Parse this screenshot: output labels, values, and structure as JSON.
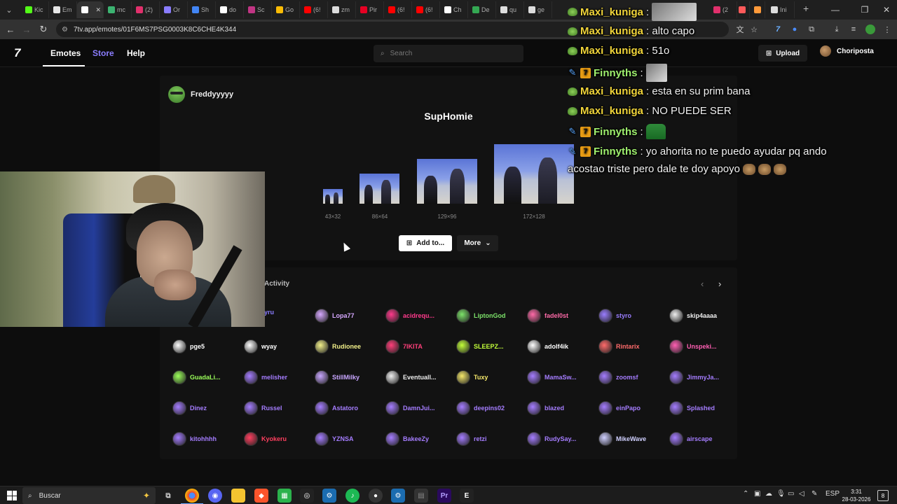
{
  "browser": {
    "tabs": [
      {
        "label": "Kic",
        "color": "#53fc18"
      },
      {
        "label": "Em",
        "color": "#e6e6e6"
      },
      {
        "label": "",
        "color": "#ffffff"
      },
      {
        "label": "mc",
        "color": "#3cb371"
      },
      {
        "label": "(2)",
        "color": "#e1306c"
      },
      {
        "label": "Or",
        "color": "#8a7dff"
      },
      {
        "label": "Sh",
        "color": "#4285f4"
      },
      {
        "label": "do",
        "color": "#ffffff"
      },
      {
        "label": "Sc",
        "color": "#c13584"
      },
      {
        "label": "Go",
        "color": "#fbbc05"
      },
      {
        "label": "(6!",
        "color": "#ff0000"
      },
      {
        "label": "zm",
        "color": "#dddddd"
      },
      {
        "label": "Pir",
        "color": "#e60023"
      },
      {
        "label": "(6!",
        "color": "#ff0000"
      },
      {
        "label": "(6!",
        "color": "#ff0000"
      },
      {
        "label": "Ch",
        "color": "#ffffff"
      },
      {
        "label": "De",
        "color": "#34a853"
      },
      {
        "label": "qu",
        "color": "#dddddd"
      },
      {
        "label": "ge",
        "color": "#dddddd"
      }
    ],
    "url": "7tv.app/emotes/01F6MS7PSG0003K8C6CHE4K344",
    "right_tabs": [
      {
        "label": "(2"
      },
      {
        "label": "Ini"
      }
    ]
  },
  "site": {
    "logo": "7",
    "nav": {
      "emotes": "Emotes",
      "store": "Store",
      "help": "Help"
    },
    "search_placeholder": "Search",
    "upload": "Upload",
    "username": "Choriposta"
  },
  "emote": {
    "uploader": "Freddyyyyy",
    "name": "SupHomie",
    "sizes": [
      "43×32",
      "86×64",
      "129×96",
      "172×128"
    ],
    "add_to": "Add to...",
    "more": "More"
  },
  "activity": {
    "title": "Activity",
    "rows": [
      [
        {
          "name": "yru",
          "color": "#8b7dff"
        },
        {
          "name": "Lopa77",
          "color": "#d6a8ff"
        },
        {
          "name": "acidrequ...",
          "color": "#ff3a8c"
        },
        {
          "name": "LiptonGod",
          "color": "#7de36a"
        },
        {
          "name": "fadel0st",
          "color": "#ff6aa8"
        },
        {
          "name": "styro",
          "color": "#9a7dff"
        },
        {
          "name": "skip4aaaa",
          "color": "#eeeeee"
        }
      ],
      [
        {
          "name": "pge5",
          "color": "#ffffff"
        },
        {
          "name": "wyay",
          "color": "#ffffff"
        },
        {
          "name": "Rudionee",
          "color": "#f2f08a"
        },
        {
          "name": "7IKITA",
          "color": "#ff3f7a"
        },
        {
          "name": "SLEEPZ...",
          "color": "#c3ff3a"
        },
        {
          "name": "adolf4ik",
          "color": "#ffffff"
        },
        {
          "name": "Rintarix",
          "color": "#ff6b6b"
        },
        {
          "name": "Unspeki...",
          "color": "#ff5fb3"
        }
      ],
      [
        {
          "name": "GuadaLi...",
          "color": "#9bff5a"
        },
        {
          "name": "melisher",
          "color": "#a57dff"
        },
        {
          "name": "StillMilky",
          "color": "#c8a6ff"
        },
        {
          "name": "Eventuall...",
          "color": "#eeeeee"
        },
        {
          "name": "Tuxy",
          "color": "#f5e86a"
        },
        {
          "name": "MamaSw...",
          "color": "#a57dff"
        },
        {
          "name": "zoomsf",
          "color": "#a57dff"
        },
        {
          "name": "JimmyJa...",
          "color": "#a57dff"
        }
      ],
      [
        {
          "name": "Dinez",
          "color": "#a57dff"
        },
        {
          "name": "Russel",
          "color": "#a57dff"
        },
        {
          "name": "Astatoro",
          "color": "#a57dff"
        },
        {
          "name": "DamnJui...",
          "color": "#a57dff"
        },
        {
          "name": "deepins02",
          "color": "#a57dff"
        },
        {
          "name": "blazed",
          "color": "#a57dff"
        },
        {
          "name": "einPapo",
          "color": "#a57dff"
        },
        {
          "name": "Splashed",
          "color": "#a57dff"
        }
      ],
      [
        {
          "name": "kitohhhh",
          "color": "#a57dff"
        },
        {
          "name": "Kyokeru",
          "color": "#ff3f5f"
        },
        {
          "name": "YZNSA",
          "color": "#a57dff"
        },
        {
          "name": "BakeeZy",
          "color": "#a57dff"
        },
        {
          "name": "retzi",
          "color": "#a57dff"
        },
        {
          "name": "RudySay...",
          "color": "#a57dff"
        },
        {
          "name": "MikeWave",
          "color": "#d0d0ff"
        },
        {
          "name": "airscape",
          "color": "#a57dff"
        }
      ]
    ]
  },
  "chat": [
    {
      "user": "Maxi_kuniga",
      "text": ":",
      "badge": "pepe"
    },
    {
      "user": "Maxi_kuniga",
      "text": ": alto capo",
      "badge": "pepe"
    },
    {
      "user": "Maxi_kuniga",
      "text": ": 51o",
      "badge": "pepe"
    },
    {
      "user": "Finnyths",
      "text": ":",
      "badge": "7tv"
    },
    {
      "user": "Maxi_kuniga",
      "text": ": esta en su prim bana",
      "badge": "pepe"
    },
    {
      "user": "Maxi_kuniga",
      "text": ": NO PUEDE SER",
      "badge": "pepe"
    },
    {
      "user": "Finnyths",
      "text": ":",
      "badge": "7tv"
    },
    {
      "user": "Finnyths",
      "text": ": yo ahorita no te puedo ayudar pq ando",
      "badge": "7tv"
    },
    {
      "user": "",
      "text": "acostao triste pero dale te doy apoyo",
      "badge": ""
    }
  ],
  "taskbar": {
    "search": "Buscar",
    "lang": "ESP",
    "time": "3:31",
    "date": "28-03-2026",
    "notif_count": "8"
  }
}
